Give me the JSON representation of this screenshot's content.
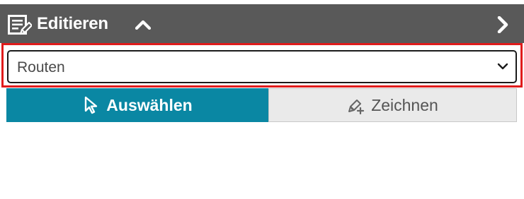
{
  "header": {
    "title": "Editieren",
    "icons": {
      "edit": "edit-form-icon",
      "collapse": "chevron-up-icon",
      "next": "chevron-right-icon"
    },
    "background": "#595959"
  },
  "layer_select": {
    "value": "Routen",
    "icon": "chevron-down-icon",
    "highlight_color": "#e01b1b"
  },
  "modes": {
    "active": "select",
    "select": {
      "label": "Auswählen",
      "icon": "cursor-arrow-icon",
      "color": "#0a87a3"
    },
    "draw": {
      "label": "Zeichnen",
      "icon": "draw-pen-plus-icon",
      "color": "#eaeaea"
    }
  }
}
